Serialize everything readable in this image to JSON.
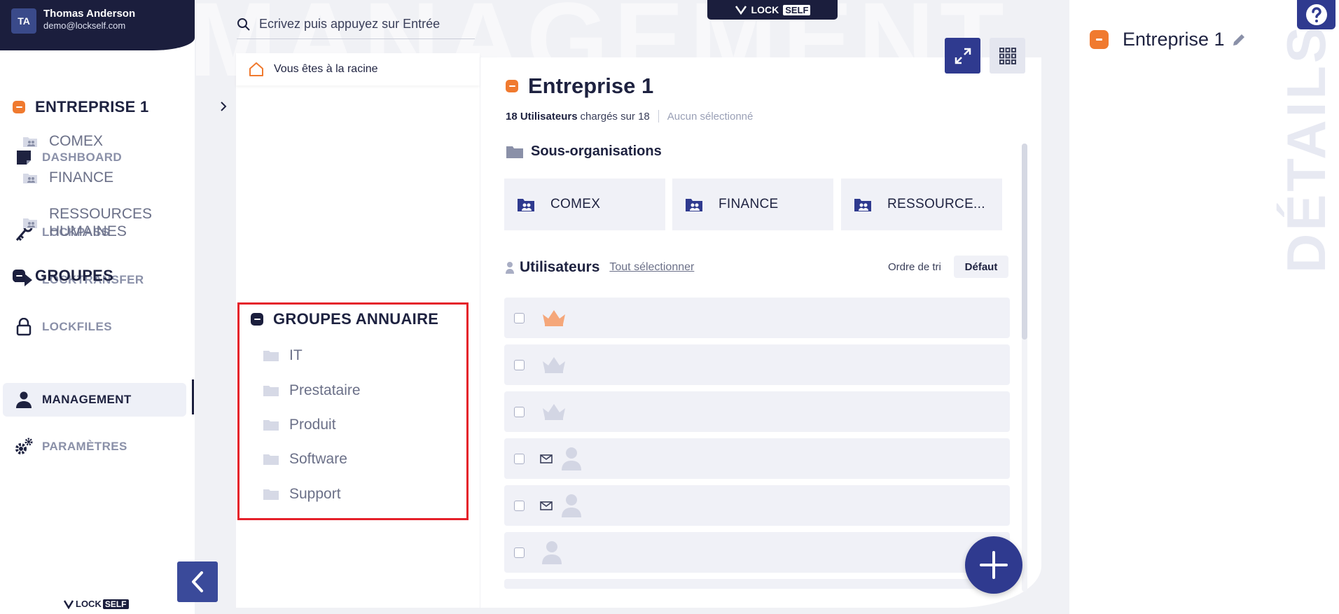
{
  "user": {
    "initials": "TA",
    "name": "Thomas Anderson",
    "email": "demo@lockself.com"
  },
  "nav": {
    "dashboard": "DASHBOARD",
    "lockpass": "LOCKPASS",
    "locktransfer": "LOCKTRANSFER",
    "lockfiles": "LOCKFILES",
    "management": "MANAGEMENT",
    "parametres": "PARAMÈTRES"
  },
  "brand": {
    "lock": "LOCK",
    "self": "SELF"
  },
  "watermark": {
    "main": "MANAGEMENT",
    "details": "DÉTAILS"
  },
  "search": {
    "placeholder": "Ecrivez puis appuyez sur Entrée"
  },
  "tree": {
    "root": "Vous êtes à la racine",
    "entreprise": "ENTREPRISE 1",
    "children": [
      "COMEX",
      "FINANCE",
      "RESSOURCES",
      "HUMAINES"
    ],
    "groupes": "GROUPES",
    "groupes_annuaire": "GROUPES ANNUAIRE",
    "annuaire_items": [
      "IT",
      "Prestataire",
      "Produit",
      "Software",
      "Support"
    ]
  },
  "main": {
    "title": "Entreprise 1",
    "users_count": "18 Utilisateurs",
    "loaded_text": "chargés sur 18",
    "selected_text": "Aucun sélectionné",
    "suborgs_title": "Sous-organisations",
    "suborgs": [
      "COMEX",
      "FINANCE",
      "RESSOURCE..."
    ],
    "users_title": "Utilisateurs",
    "select_all": "Tout sélectionner",
    "sort_label": "Ordre de tri",
    "sort_value": "Défaut"
  },
  "details": {
    "title": "Entreprise 1"
  },
  "colors": {
    "accent": "#2f3a8f",
    "orange": "#f07a2f",
    "dark": "#1b1e3d",
    "highlight": "#e5202a"
  }
}
